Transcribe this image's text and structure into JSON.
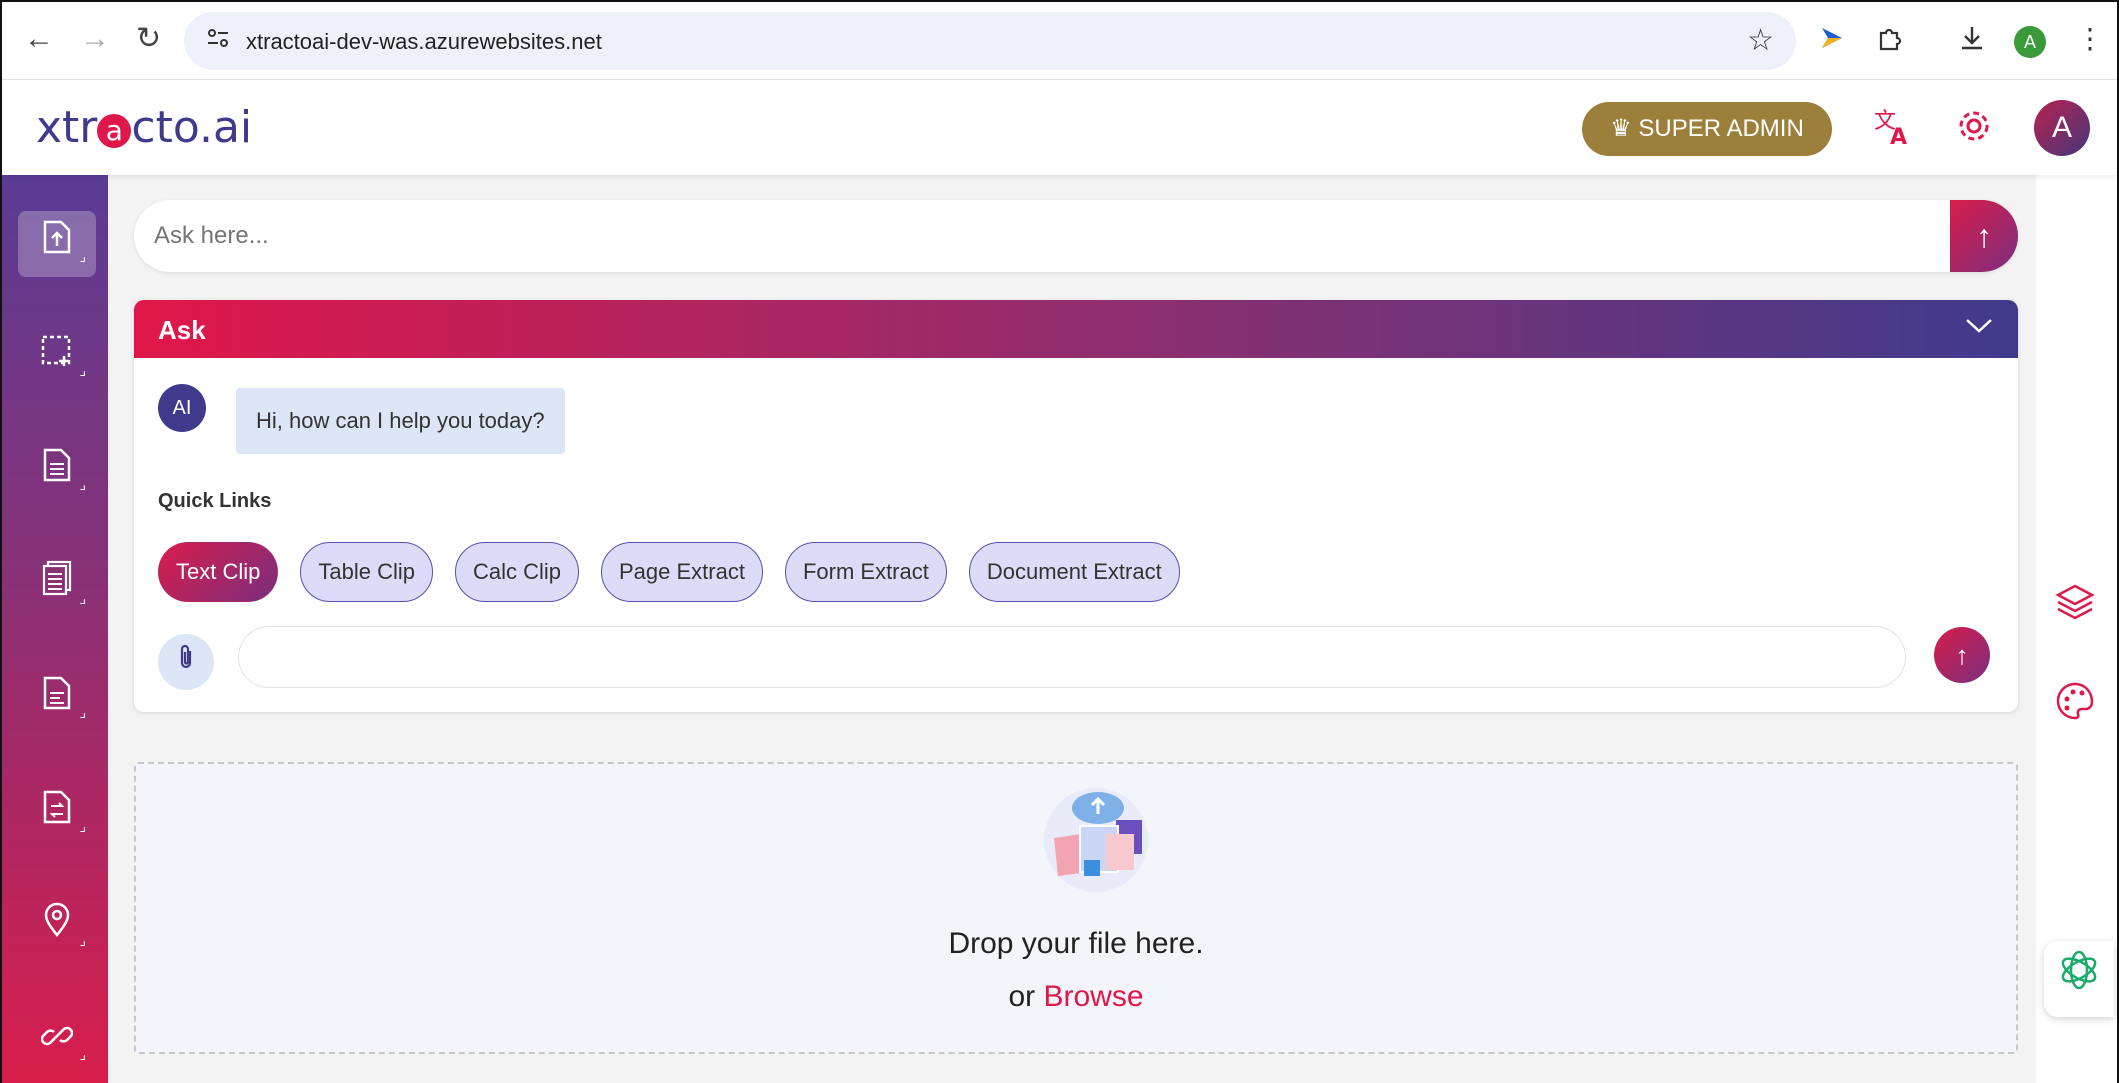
{
  "browser": {
    "url": "xtractoai-dev-was.azurewebsites.net",
    "back_icon": "←",
    "forward_icon": "→",
    "reload_icon": "↻",
    "profile_initial": "A"
  },
  "header": {
    "logo_pre": "xtr",
    "logo_o": "a",
    "logo_post": "cto.ai",
    "admin_icon": "♛",
    "admin_label": "SUPER ADMIN",
    "avatar_initial": "A"
  },
  "sidebar": {
    "items": [
      {
        "icon": "upload-file-icon"
      },
      {
        "icon": "region-select-icon"
      },
      {
        "icon": "document-list-icon"
      },
      {
        "icon": "multi-document-icon"
      },
      {
        "icon": "document-edit-icon"
      },
      {
        "icon": "document-compare-icon"
      },
      {
        "icon": "location-pin-icon"
      },
      {
        "icon": "link-icon"
      }
    ]
  },
  "search": {
    "placeholder": "Ask here..."
  },
  "ask_panel": {
    "title": "Ask",
    "ai_badge": "AI",
    "greeting": "Hi, how can I help you today?",
    "quick_links_label": "Quick Links",
    "quick_links": [
      "Text Clip",
      "Table Clip",
      "Calc Clip",
      "Page Extract",
      "Form Extract",
      "Document Extract"
    ],
    "active_quick_link": "Text Clip"
  },
  "dropzone": {
    "text": "Drop your file here.",
    "or": "or",
    "browse": "Browse"
  },
  "colors": {
    "accent": "#e0174a",
    "brand_purple": "#3f3a8c",
    "admin_gold": "#9c7f3b",
    "bot_green": "#1aaa6a"
  }
}
